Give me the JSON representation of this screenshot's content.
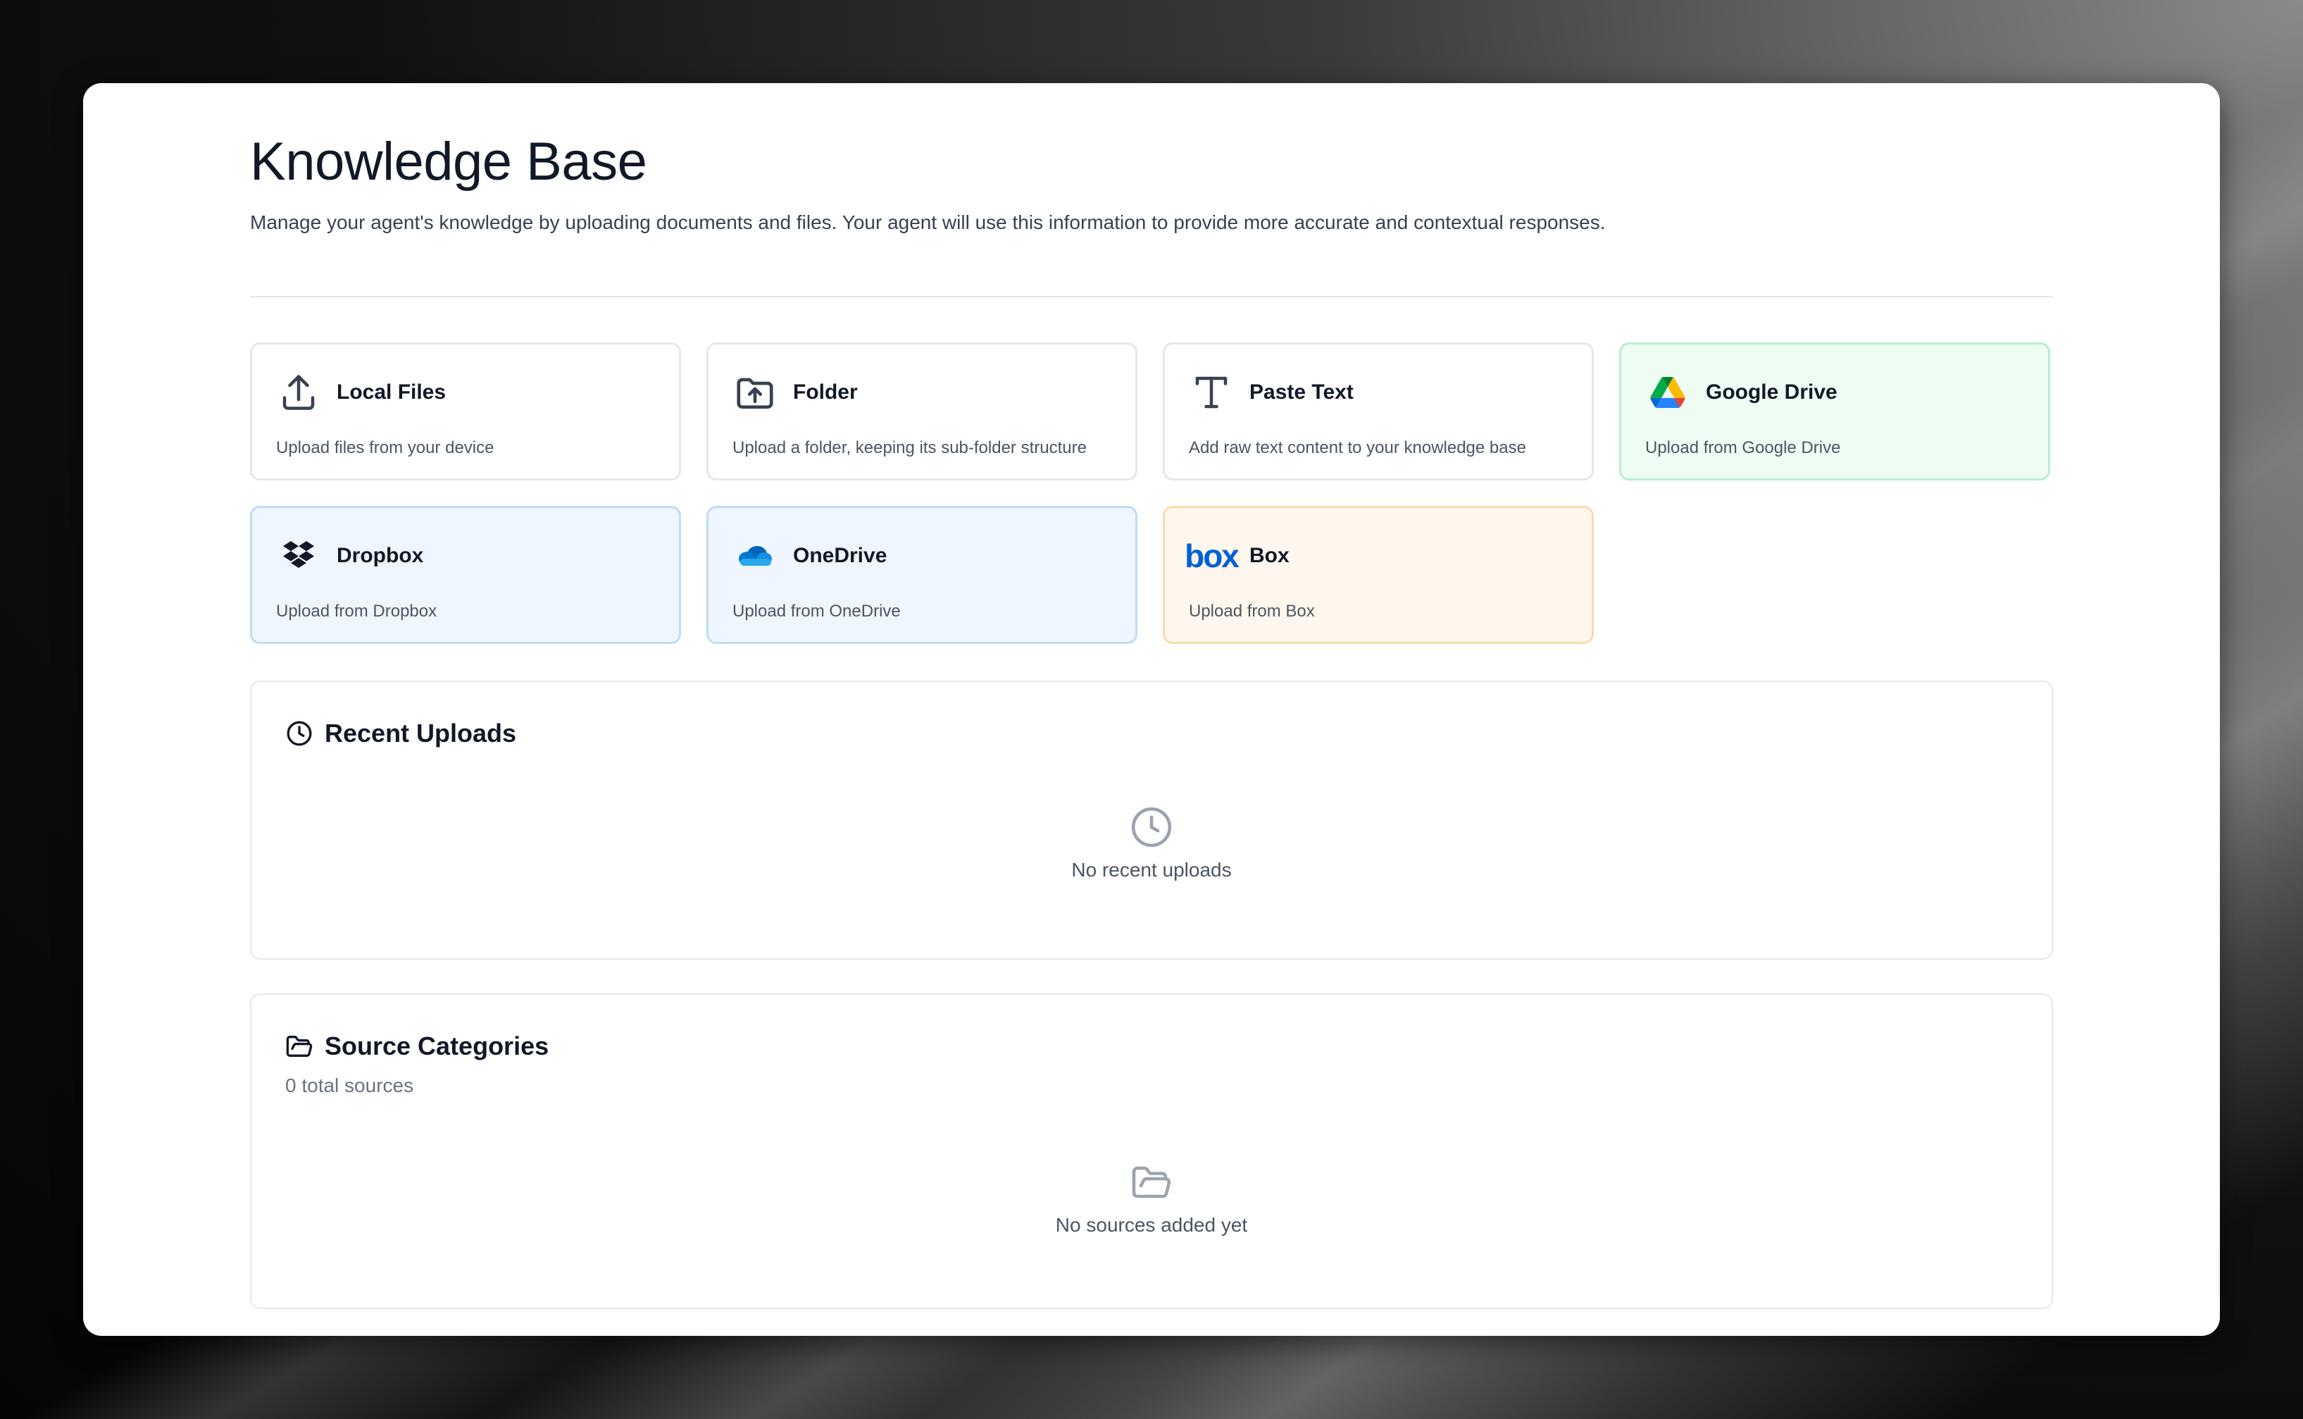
{
  "page": {
    "title": "Knowledge Base",
    "description": "Manage your agent's knowledge by uploading documents and files. Your agent will use this information to provide more accurate and contextual responses."
  },
  "sources": [
    {
      "title": "Local Files",
      "description": "Upload files from your device",
      "icon": "upload-icon",
      "style": "neutral"
    },
    {
      "title": "Folder",
      "description": "Upload a folder, keeping its sub-folder structure",
      "icon": "folder-upload-icon",
      "style": "neutral"
    },
    {
      "title": "Paste Text",
      "description": "Add raw text content to your knowledge base",
      "icon": "text-icon",
      "style": "neutral"
    },
    {
      "title": "Google Drive",
      "description": "Upload from Google Drive",
      "icon": "google-drive-icon",
      "style": "green"
    },
    {
      "title": "Dropbox",
      "description": "Upload from Dropbox",
      "icon": "dropbox-icon",
      "style": "blue"
    },
    {
      "title": "OneDrive",
      "description": "Upload from OneDrive",
      "icon": "onedrive-icon",
      "style": "blue"
    },
    {
      "title": "Box",
      "description": "Upload from Box",
      "icon": "box-icon",
      "style": "orange",
      "logo_text": "box"
    }
  ],
  "recent_uploads": {
    "title": "Recent Uploads",
    "empty_text": "No recent uploads",
    "icon": "clock-icon"
  },
  "source_categories": {
    "title": "Source Categories",
    "subtitle": "0 total sources",
    "empty_text": "No sources added yet",
    "icon": "folder-open-icon"
  },
  "colors": {
    "google_green": "#34A853",
    "google_blue": "#4285F4",
    "google_yellow": "#FBBC04",
    "onedrive_blue": "#0F78D4",
    "box_blue": "#0061D5"
  }
}
